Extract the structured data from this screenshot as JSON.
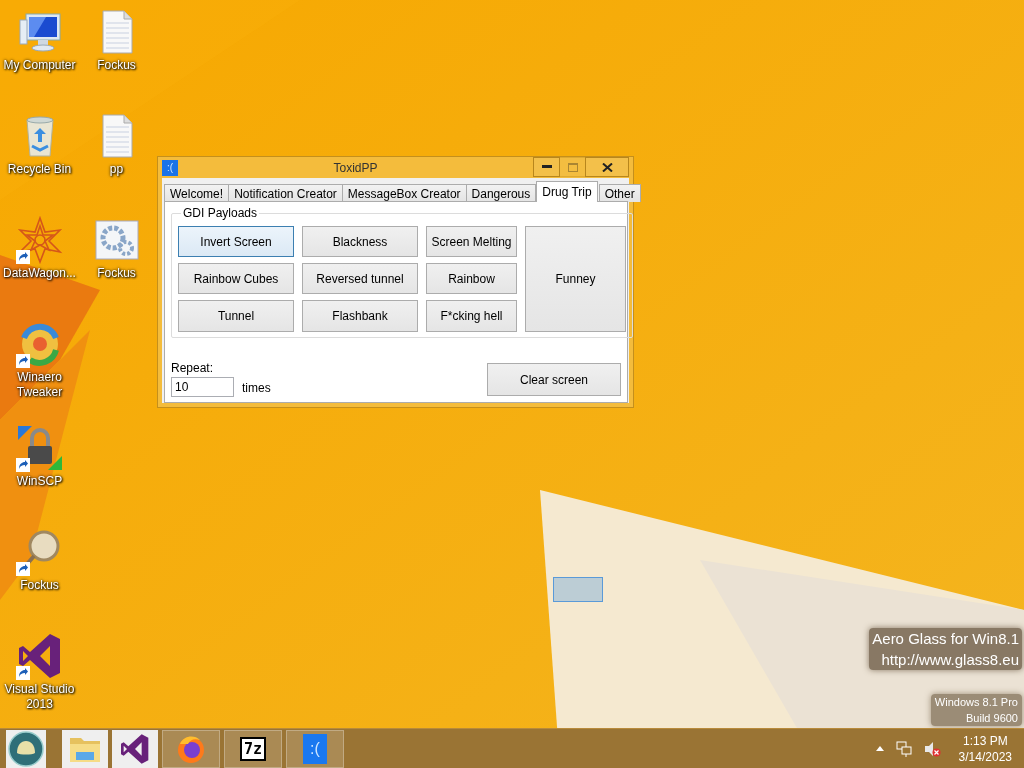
{
  "desktop": {
    "columns": [
      [
        {
          "label": "My Computer",
          "kind": "computer",
          "shortcut": false
        },
        {
          "label": "Recycle Bin",
          "kind": "recycle-bin",
          "shortcut": false
        },
        {
          "label": "DataWagon...",
          "kind": "star",
          "shortcut": true
        },
        {
          "label": "Winaero Tweaker",
          "kind": "swirl",
          "shortcut": true
        },
        {
          "label": "WinSCP",
          "kind": "padlock",
          "shortcut": true
        },
        {
          "label": "Fockus",
          "kind": "magnifier",
          "shortcut": true
        },
        {
          "label": "Visual Studio 2013",
          "kind": "visual-studio",
          "shortcut": true
        }
      ],
      [
        {
          "label": "Fockus",
          "kind": "document",
          "shortcut": false
        },
        {
          "label": "pp",
          "kind": "document",
          "shortcut": false
        },
        {
          "label": "Fockus",
          "kind": "gears",
          "shortcut": false
        }
      ]
    ],
    "overlay_text": [
      "Aero Glass for Win8.1",
      "http://www.glass8.eu"
    ],
    "edition_text": [
      "Windows 8.1 Pro",
      "Build 9600"
    ]
  },
  "window": {
    "title": "ToxidPP",
    "icon_text": ":(",
    "title_buttons": [
      {
        "kind": "minimize",
        "disabled": false
      },
      {
        "kind": "maximize",
        "disabled": true
      },
      {
        "kind": "close",
        "disabled": false
      }
    ],
    "tabs": [
      {
        "label": "Welcome!",
        "selected": false
      },
      {
        "label": "Notification Creator",
        "selected": false
      },
      {
        "label": "MessageBox Creator",
        "selected": false
      },
      {
        "label": "Dangerous",
        "selected": false
      },
      {
        "label": "Drug Trip",
        "selected": true
      },
      {
        "label": "Other",
        "selected": false
      }
    ],
    "group": {
      "title": "GDI Payloads",
      "buttons": [
        {
          "label": "Invert Screen",
          "focused": true
        },
        {
          "label": "Blackness",
          "focused": false
        },
        {
          "label": "Screen Melting",
          "focused": false
        },
        {
          "label": "Rainbow Cubes",
          "focused": false
        },
        {
          "label": "Reversed tunnel",
          "focused": false
        },
        {
          "label": "Rainbow",
          "focused": false
        },
        {
          "label": "Funney",
          "focused": false,
          "kind": "tall"
        },
        {
          "label": "Tunnel",
          "focused": false
        },
        {
          "label": "Flashbank",
          "focused": false
        },
        {
          "label": "F*cking hell",
          "focused": false
        }
      ]
    },
    "repeat_label": "Repeat:",
    "repeat_value": "10",
    "repeat_unit": "times",
    "clear_button": "Clear screen"
  },
  "taskbar": {
    "items": [
      {
        "kind": "start",
        "open": false
      },
      {
        "kind": "folder",
        "open": false
      },
      {
        "kind": "visual-studio",
        "open": false
      },
      {
        "kind": "firefox",
        "open": true
      },
      {
        "kind": "sevenzip",
        "label": "7z",
        "open": true
      },
      {
        "kind": "app",
        "label": ":(",
        "open": true
      }
    ],
    "tray": [
      {
        "kind": "caret"
      },
      {
        "kind": "network"
      },
      {
        "kind": "speaker",
        "muted": true
      }
    ],
    "time": "1:13 PM",
    "date": "3/14/2023"
  }
}
